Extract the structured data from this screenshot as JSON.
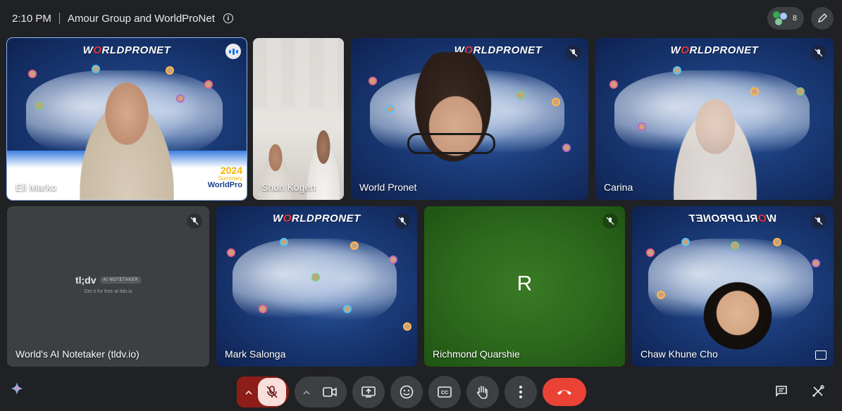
{
  "header": {
    "time": "2:10 PM",
    "meeting_title": "Amour Group and WorldProNet",
    "people_count": "8"
  },
  "tiles": [
    {
      "name": "Eli Marko",
      "muted": false,
      "speaking": true
    },
    {
      "name": "Shon Kogen",
      "muted": false
    },
    {
      "name": "World Pronet",
      "muted": true
    },
    {
      "name": "Carina",
      "muted": true
    },
    {
      "name": "World's AI Notetaker (tldv.io)",
      "muted": true
    },
    {
      "name": "Mark Salonga",
      "muted": true
    },
    {
      "name": "Richmond Quarshie",
      "muted": true,
      "avatar_letter": "R"
    },
    {
      "name": "Chaw Khune Cho",
      "muted": true
    }
  ],
  "background": {
    "logo_prefix": "W",
    "logo_o": "O",
    "logo_suffix": "RLDPRONET",
    "self_banner_year": "2024",
    "self_banner_word": "Summary",
    "self_banner_brand": "WorldPro"
  },
  "tldv": {
    "name": "tl;dv",
    "badge": "AI NOTETAKER",
    "sub": "Get it for free at tldv.io"
  },
  "colors": {
    "accent": "#8ab4f8",
    "end_call": "#ea4335",
    "mic_off_bg": "#f9dedc",
    "richmond_tile": "#33691e"
  }
}
